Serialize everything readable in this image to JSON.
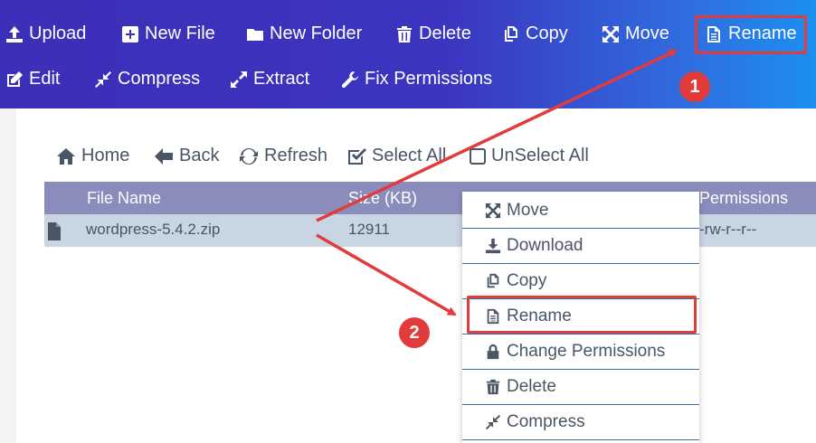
{
  "toolbar": {
    "row1": [
      {
        "label": "Upload",
        "icon": "upload-icon"
      },
      {
        "label": "New File",
        "icon": "plus-square-icon"
      },
      {
        "label": "New Folder",
        "icon": "folder-icon"
      },
      {
        "label": "Delete",
        "icon": "trash-icon"
      },
      {
        "label": "Copy",
        "icon": "copy-icon"
      },
      {
        "label": "Move",
        "icon": "move-arrows-icon"
      },
      {
        "label": "Rename",
        "icon": "file-text-icon"
      }
    ],
    "row2": [
      {
        "label": "Edit",
        "icon": "edit-icon"
      },
      {
        "label": "Compress",
        "icon": "compress-icon"
      },
      {
        "label": "Extract",
        "icon": "expand-icon"
      },
      {
        "label": "Fix Permissions",
        "icon": "wrench-icon"
      }
    ]
  },
  "nav": {
    "home": "Home",
    "back": "Back",
    "refresh": "Refresh",
    "select_all": "Select All",
    "unselect_all": "UnSelect All"
  },
  "table": {
    "headers": {
      "name": "File Name",
      "size": "Size (KB)",
      "permissions": "Permissions"
    },
    "rows": [
      {
        "name": "wordpress-5.4.2.zip",
        "size": "12911",
        "permissions": "-rw-r--r--"
      }
    ]
  },
  "context_menu": {
    "items": [
      {
        "label": "Move",
        "icon": "move-arrows-icon"
      },
      {
        "label": "Download",
        "icon": "download-icon"
      },
      {
        "label": "Copy",
        "icon": "copy-icon"
      },
      {
        "label": "Rename",
        "icon": "file-text-icon"
      },
      {
        "label": "Change Permissions",
        "icon": "lock-icon"
      },
      {
        "label": "Delete",
        "icon": "trash-icon"
      },
      {
        "label": "Compress",
        "icon": "compress-icon"
      }
    ]
  },
  "annotations": {
    "badge1": "1",
    "badge2": "2",
    "highlight_color": "#e03c3c"
  },
  "colors": {
    "toolbar_start": "#3c2fb8",
    "toolbar_end": "#1c8ff0",
    "table_header": "#8a8dbb",
    "selected_row": "#c8d5e3",
    "menu_divider": "#2f6fb5"
  }
}
